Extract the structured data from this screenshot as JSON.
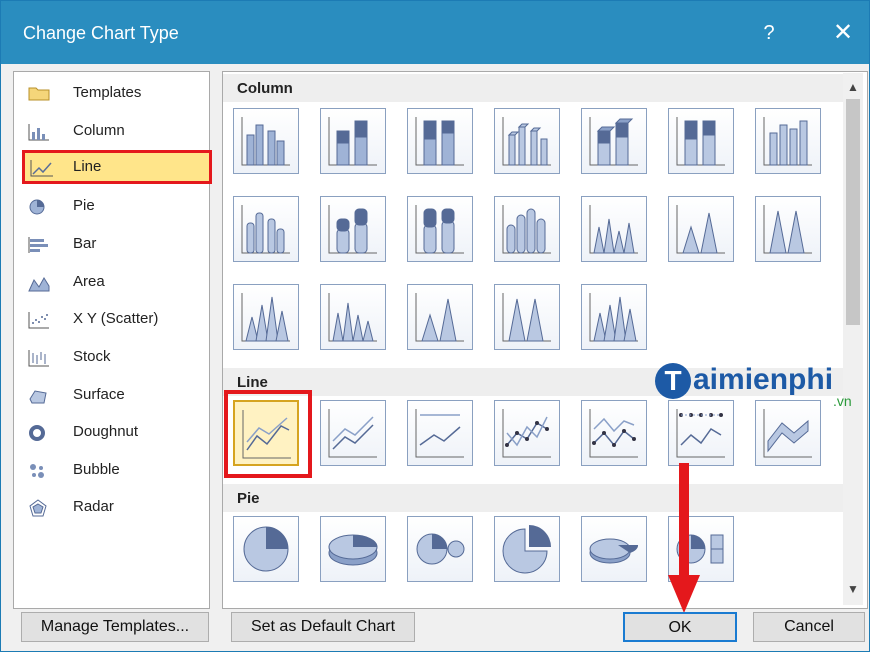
{
  "dialog": {
    "title": "Change Chart Type",
    "help": "?",
    "close": "✕"
  },
  "categories": [
    {
      "label": "Templates",
      "icon": "folder-icon",
      "selected": false
    },
    {
      "label": "Column",
      "icon": "column-chart-icon",
      "selected": false
    },
    {
      "label": "Line",
      "icon": "line-chart-icon",
      "selected": true
    },
    {
      "label": "Pie",
      "icon": "pie-chart-icon",
      "selected": false
    },
    {
      "label": "Bar",
      "icon": "bar-chart-icon",
      "selected": false
    },
    {
      "label": "Area",
      "icon": "area-chart-icon",
      "selected": false
    },
    {
      "label": "X Y (Scatter)",
      "icon": "scatter-chart-icon",
      "selected": false
    },
    {
      "label": "Stock",
      "icon": "stock-chart-icon",
      "selected": false
    },
    {
      "label": "Surface",
      "icon": "surface-chart-icon",
      "selected": false
    },
    {
      "label": "Doughnut",
      "icon": "doughnut-chart-icon",
      "selected": false
    },
    {
      "label": "Bubble",
      "icon": "bubble-chart-icon",
      "selected": false
    },
    {
      "label": "Radar",
      "icon": "radar-chart-icon",
      "selected": false
    }
  ],
  "sections": {
    "column": "Column",
    "line": "Line",
    "pie": "Pie"
  },
  "buttons": {
    "manage": "Manage Templates...",
    "set_default": "Set as Default Chart",
    "ok": "OK",
    "cancel": "Cancel"
  },
  "watermark": {
    "logo": "T",
    "text": "aimienphi",
    "suffix": ".vn"
  },
  "colors": {
    "title_bar": "#2a8dbf",
    "selection": "#ffe58a",
    "highlight_red": "#e4181c"
  }
}
